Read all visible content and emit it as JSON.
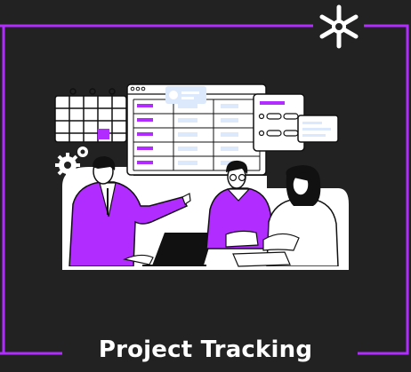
{
  "caption": {
    "title": "Project Tracking"
  },
  "colors": {
    "background": "#222222",
    "accent": "#b02cff",
    "ink": "#111111",
    "paper": "#ffffff",
    "light-blue": "#dce8fb"
  },
  "icons": {
    "brand": "asterisk-logo-icon",
    "settings": "gear-icon"
  }
}
